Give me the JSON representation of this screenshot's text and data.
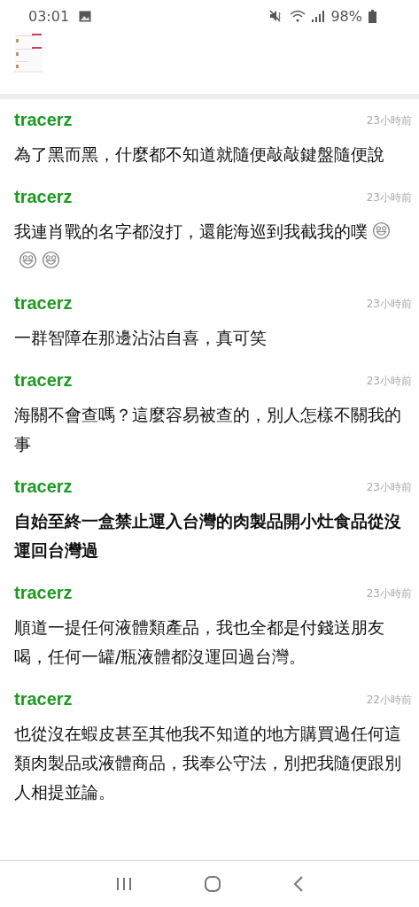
{
  "status_bar": {
    "time": "03:01",
    "battery": "98%"
  },
  "comments": [
    {
      "user": "tracerz",
      "time": "23小時前",
      "text": "為了黑而黑，什麼都不知道就隨便敲敲鍵盤隨便說",
      "bold": false
    },
    {
      "user": "tracerz",
      "time": "23小時前",
      "text": "我連肖戰的名字都沒打，還能海巡到我截我的噗",
      "bold": false,
      "trailing_icons": [
        {
          "kind": "emoji"
        },
        {
          "kind": "emoji"
        },
        {
          "kind": "emoji"
        }
      ]
    },
    {
      "user": "tracerz",
      "time": "23小時前",
      "text": "一群智障在那邊沾沾自喜，真可笑",
      "bold": false
    },
    {
      "user": "tracerz",
      "time": "23小時前",
      "text": "海關不會查嗎？這麼容易被查的，別人怎樣不關我的事",
      "bold": false
    },
    {
      "user": "tracerz",
      "time": "23小時前",
      "text": "自始至終一盒禁止運入台灣的肉製品開小灶食品從沒運回台灣過",
      "bold": true
    },
    {
      "user": "tracerz",
      "time": "23小時前",
      "text": "順道一提任何液體類產品，我也全都是付錢送朋友喝，任何一罐/瓶液體都沒運回過台灣。",
      "bold": false
    },
    {
      "user": "tracerz",
      "time": "22小時前",
      "text": "也從沒在蝦皮甚至其他我不知道的地方購買過任何這類肉製品或液體商品，我奉公守法，別把我隨便跟別人相提並論。",
      "bold": false
    }
  ]
}
